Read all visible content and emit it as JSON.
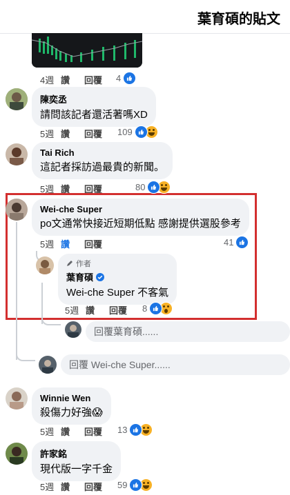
{
  "header": {
    "title": "葉育碩的貼文"
  },
  "colors": {
    "accent": "#1b74e4",
    "highlight_border": "#d32f2f"
  },
  "top_item": {
    "time": "4週",
    "like_label": "讚",
    "reply_label": "回覆",
    "like_count": "4"
  },
  "comments": [
    {
      "author": "陳奕丞",
      "text": "請問該記者還活著嗎XD",
      "time": "5週",
      "like_label": "讚",
      "reply_label": "回覆",
      "reaction_count": "109"
    },
    {
      "author": "Tai Rich",
      "text": "這記者採訪過最貴的新聞。",
      "time": "5週",
      "like_label": "讚",
      "reply_label": "回覆",
      "reaction_count": "80"
    },
    {
      "author": "Wei-che Super",
      "text": "po文通常快接近短期低點 感謝提供選股參考",
      "time": "5週",
      "like_label": "讚",
      "reply_label": "回覆",
      "reaction_count": "41"
    },
    {
      "author": "Winnie Wen",
      "text": "殺傷力好強😱",
      "time": "5週",
      "like_label": "讚",
      "reply_label": "回覆",
      "reaction_count": "13"
    },
    {
      "author": "許家銘",
      "text": "現代版一字千金",
      "time": "5週",
      "like_label": "讚",
      "reply_label": "回覆",
      "reaction_count": "59"
    }
  ],
  "author_reply": {
    "badge": "作者",
    "author": "葉育碩",
    "text": "Wei-che Super 不客氣",
    "time": "5週",
    "like_label": "讚",
    "reply_label": "回覆",
    "reaction_count": "8"
  },
  "reply_inputs": {
    "nested_placeholder": "回覆葉育碩......",
    "thread_placeholder": "回覆 Wei-che Super......"
  }
}
